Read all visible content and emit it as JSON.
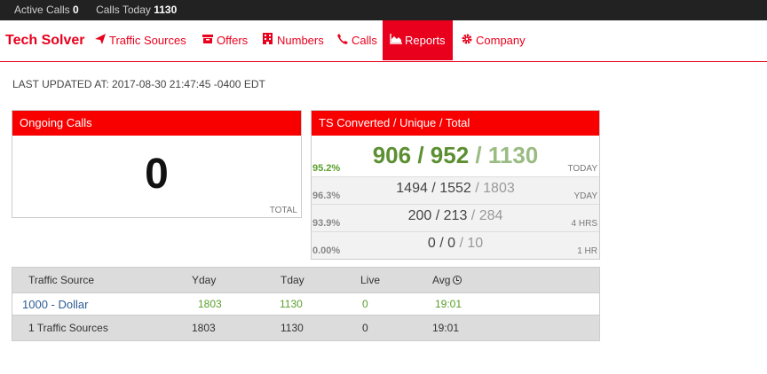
{
  "statusbar": {
    "active_calls_label": "Active Calls",
    "active_calls_value": "0",
    "calls_today_label": "Calls Today",
    "calls_today_value": "1130"
  },
  "nav": {
    "brand": "Tech Solver",
    "items": [
      {
        "label": "Traffic Sources",
        "icon": "paper-plane-icon"
      },
      {
        "label": "Offers",
        "icon": "archive-icon"
      },
      {
        "label": "Numbers",
        "icon": "building-icon"
      },
      {
        "label": "Calls",
        "icon": "phone-icon"
      },
      {
        "label": "Reports",
        "icon": "area-chart-icon",
        "active": true
      },
      {
        "label": "Company",
        "icon": "gear-icon"
      }
    ]
  },
  "last_updated": "LAST UPDATED AT: 2017-08-30 21:47:45 -0400 EDT",
  "ongoing": {
    "title": "Ongoing Calls",
    "value": "0",
    "footer": "TOTAL"
  },
  "ts": {
    "title": "TS Converted / Unique / Total",
    "rows": [
      {
        "pct": "95.2%",
        "converted": "906",
        "unique": "952",
        "total": "1130",
        "period": "TODAY"
      },
      {
        "pct": "96.3%",
        "converted": "1494",
        "unique": "1552",
        "total": "1803",
        "period": "YDAY"
      },
      {
        "pct": "93.9%",
        "converted": "200",
        "unique": "213",
        "total": "284",
        "period": "4 HRS"
      },
      {
        "pct": "0.00%",
        "converted": "0",
        "unique": "0",
        "total": "10",
        "period": "1 HR"
      }
    ]
  },
  "table": {
    "headers": [
      "Traffic Source",
      "Yday",
      "Tday",
      "Live",
      "Avg"
    ],
    "rows": [
      {
        "source": "1000 - Dollar",
        "yday": "1803",
        "tday": "1130",
        "live": "0",
        "avg": "19:01"
      }
    ],
    "footer": {
      "source": "1 Traffic Sources",
      "yday": "1803",
      "tday": "1130",
      "live": "0",
      "avg": "19:01"
    }
  },
  "colors": {
    "brand_red": "#e8001c",
    "panel_red": "#f90000",
    "green": "#5aa02c",
    "link_blue": "#2e5c91"
  }
}
